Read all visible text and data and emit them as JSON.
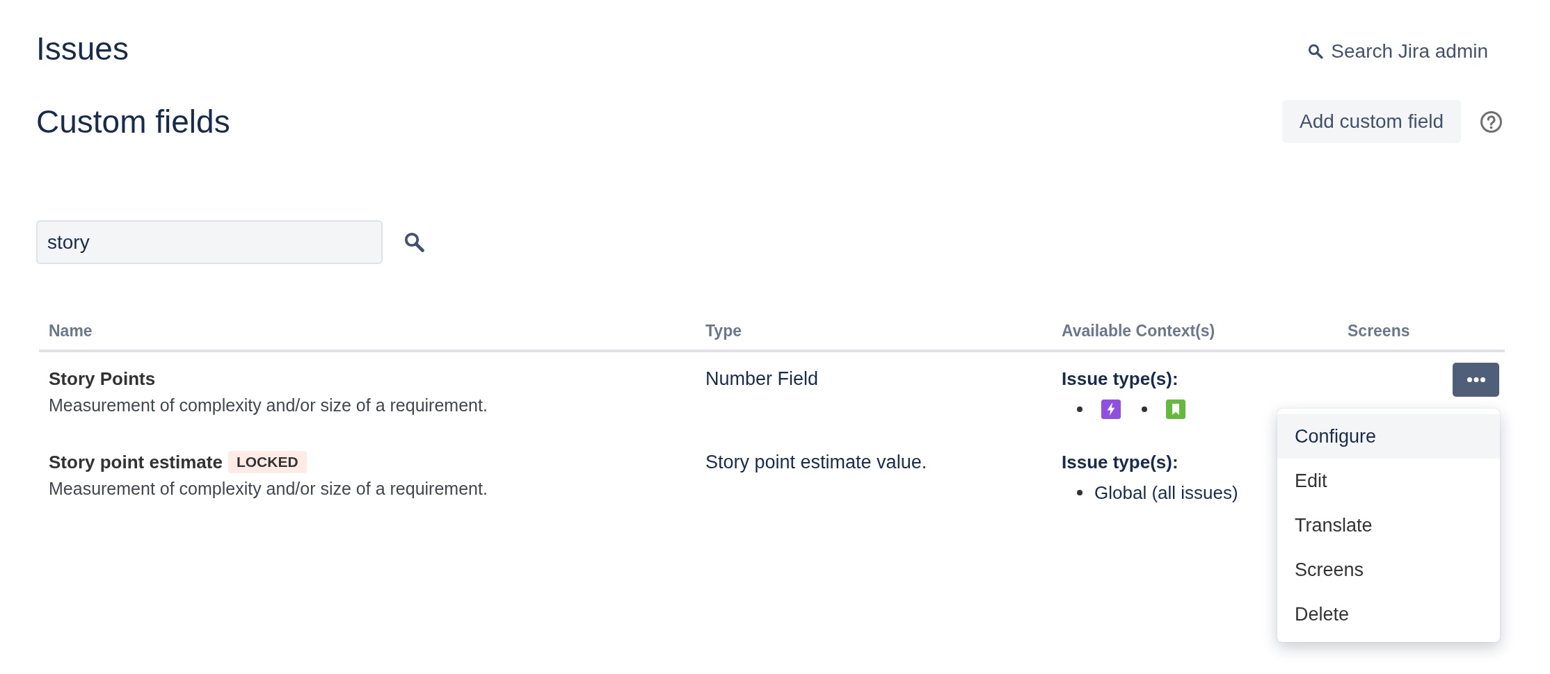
{
  "header": {
    "title": "Issues",
    "admin_search": "Search Jira admin"
  },
  "page": {
    "title": "Custom fields",
    "add_button": "Add custom field"
  },
  "search": {
    "value": "story"
  },
  "table": {
    "columns": [
      "Name",
      "Type",
      "Available Context(s)",
      "Screens"
    ],
    "rows": [
      {
        "name": "Story Points",
        "description": "Measurement of complexity and/or size of a requirement.",
        "type": "Number Field",
        "context": {
          "label": "Issue type(s):",
          "items": [
            {
              "kind": "bolt",
              "color": "#904ee2"
            },
            {
              "kind": "bookmark",
              "color": "#63ba3c"
            }
          ]
        },
        "menu_open": true
      },
      {
        "name": "Story point estimate",
        "badge": "LOCKED",
        "description": "Measurement of complexity and/or size of a requirement.",
        "type": "Story point estimate value.",
        "context": {
          "label": "Issue type(s):",
          "items": [
            {
              "kind": "text",
              "text": "Global (all issues)"
            }
          ]
        },
        "menu_open": false
      }
    ],
    "menu": {
      "items": [
        {
          "label": "Configure",
          "selected": true
        },
        {
          "label": "Edit",
          "selected": false
        },
        {
          "label": "Translate",
          "selected": false
        },
        {
          "label": "Screens",
          "selected": false
        },
        {
          "label": "Delete",
          "selected": false
        }
      ]
    }
  }
}
